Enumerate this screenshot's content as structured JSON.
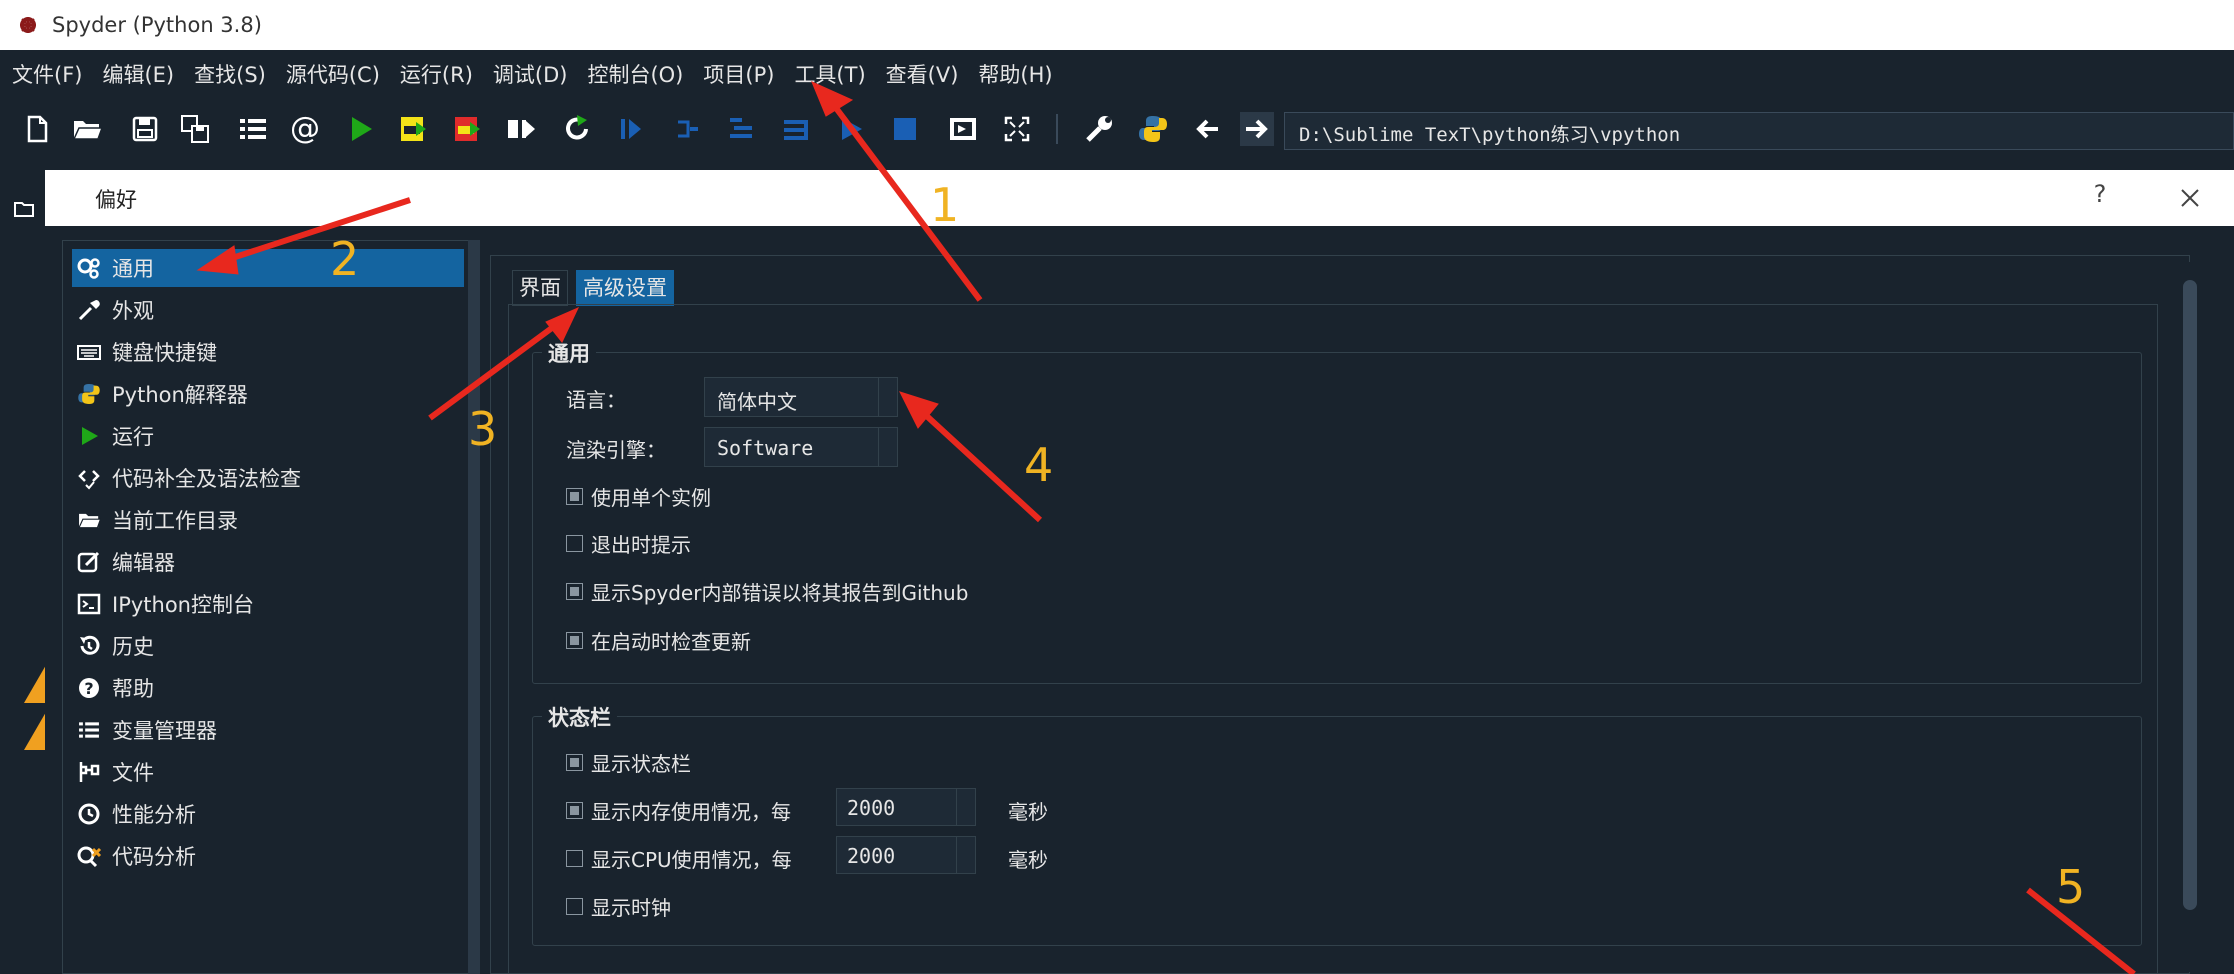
{
  "window": {
    "title": "Spyder (Python 3.8)"
  },
  "menubar": [
    "文件(F)",
    "编辑(E)",
    "查找(S)",
    "源代码(C)",
    "运行(R)",
    "调试(D)",
    "控制台(O)",
    "项目(P)",
    "工具(T)",
    "查看(V)",
    "帮助(H)"
  ],
  "toolbar": {
    "path": "D:\\Sublime TexT\\python练习\\vpython"
  },
  "dialog": {
    "title": "偏好",
    "help": "?"
  },
  "sidebar": {
    "items": [
      {
        "label": "通用",
        "icon": "gears-icon"
      },
      {
        "label": "外观",
        "icon": "eyedropper-icon"
      },
      {
        "label": "键盘快捷键",
        "icon": "keyboard-icon"
      },
      {
        "label": "Python解释器",
        "icon": "python-icon"
      },
      {
        "label": "运行",
        "icon": "play-icon"
      },
      {
        "label": "代码补全及语法检查",
        "icon": "code-check-icon"
      },
      {
        "label": "当前工作目录",
        "icon": "folder-icon"
      },
      {
        "label": "编辑器",
        "icon": "edit-icon"
      },
      {
        "label": "IPython控制台",
        "icon": "terminal-icon"
      },
      {
        "label": "历史",
        "icon": "history-icon"
      },
      {
        "label": "帮助",
        "icon": "help-icon"
      },
      {
        "label": "变量管理器",
        "icon": "list-icon"
      },
      {
        "label": "文件",
        "icon": "files-icon"
      },
      {
        "label": "性能分析",
        "icon": "clock-icon"
      },
      {
        "label": "代码分析",
        "icon": "code-analysis-icon"
      }
    ],
    "active": 0
  },
  "tabs": {
    "interface": "界面",
    "advanced": "高级设置"
  },
  "general": {
    "title": "通用",
    "language_label": "语言：",
    "language_value": "简体中文",
    "render_label": "渲染引擎：",
    "render_value": "Software",
    "single_instance": {
      "label": "使用单个实例",
      "checked": true
    },
    "prompt_exit": {
      "label": "退出时提示",
      "checked": false
    },
    "show_errors": {
      "label": "显示Spyder内部错误以将其报告到Github",
      "checked": true
    },
    "check_updates": {
      "label": "在启动时检查更新",
      "checked": true
    }
  },
  "statusbar": {
    "title": "状态栏",
    "show_statusbar": {
      "label": "显示状态栏",
      "checked": true
    },
    "show_memory": {
      "label": "显示内存使用情况，每",
      "checked": true,
      "value": "2000",
      "unit": "毫秒"
    },
    "show_cpu": {
      "label": "显示CPU使用情况，每",
      "checked": false,
      "value": "2000",
      "unit": "毫秒"
    },
    "show_clock": {
      "label": "显示时钟",
      "checked": false
    }
  },
  "annotations": [
    "1",
    "2",
    "3",
    "4",
    "5"
  ],
  "colors": {
    "background": "#19232d",
    "accent": "#1464a0",
    "annotation_arrow": "#e8281e",
    "annotation_number": "#f0b323"
  }
}
